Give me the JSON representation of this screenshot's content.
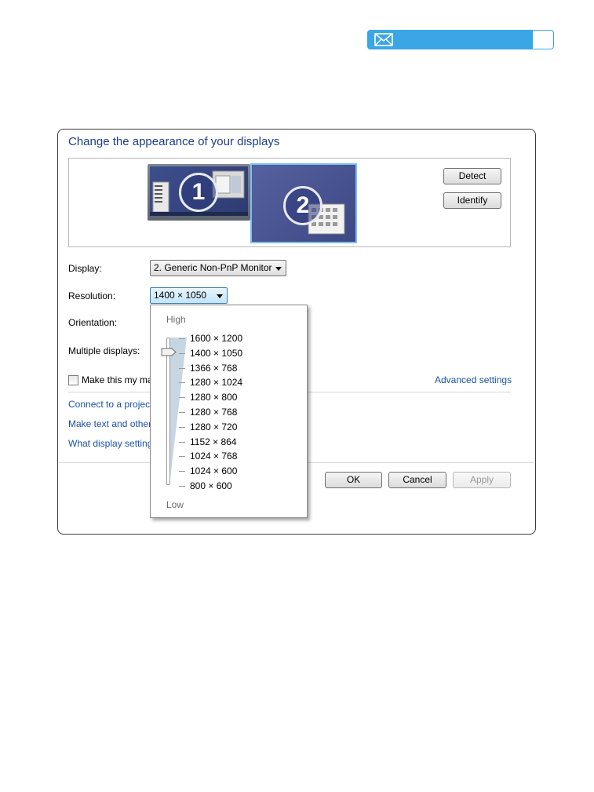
{
  "window": {
    "title": "Change the appearance of your displays"
  },
  "monitors": {
    "monitor_1_number": "1",
    "monitor_2_number": "2"
  },
  "buttons": {
    "detect": "Detect",
    "identify": "Identify",
    "ok": "OK",
    "cancel": "Cancel",
    "apply": "Apply"
  },
  "fields": {
    "display_label": "Display:",
    "display_value": "2. Generic Non-PnP Monitor",
    "resolution_label": "Resolution:",
    "resolution_value": "1400 × 1050",
    "orientation_label": "Orientation:",
    "multiple_displays_label": "Multiple displays:",
    "main_display_checkbox_label": "Make this my ma",
    "main_display_checked": false
  },
  "links": {
    "advanced_settings": "Advanced settings",
    "connect_projector": "Connect to a projec",
    "make_text_larger": "Make text and other",
    "what_display_settings": "What display setting"
  },
  "resolution_dropdown": {
    "high_label": "High",
    "low_label": "Low",
    "options": [
      "1600 × 1200",
      "1400 × 1050",
      "1366 × 768",
      "1280 × 1024",
      "1280 × 800",
      "1280 × 768",
      "1280 × 720",
      "1152 × 864",
      "1024 × 768",
      "1024 × 600",
      "800 × 600"
    ],
    "selected_index": 1
  },
  "colors": {
    "mail_bar": "#3aa6e6",
    "title_text": "#1a3e8c",
    "link_text": "#1a52a8",
    "selection_border": "#7fc0f0"
  },
  "icons": {
    "mail": "envelope-icon",
    "dropdown_arrow": "chevron-down-icon",
    "slider_thumb": "slider-thumb-icon"
  }
}
